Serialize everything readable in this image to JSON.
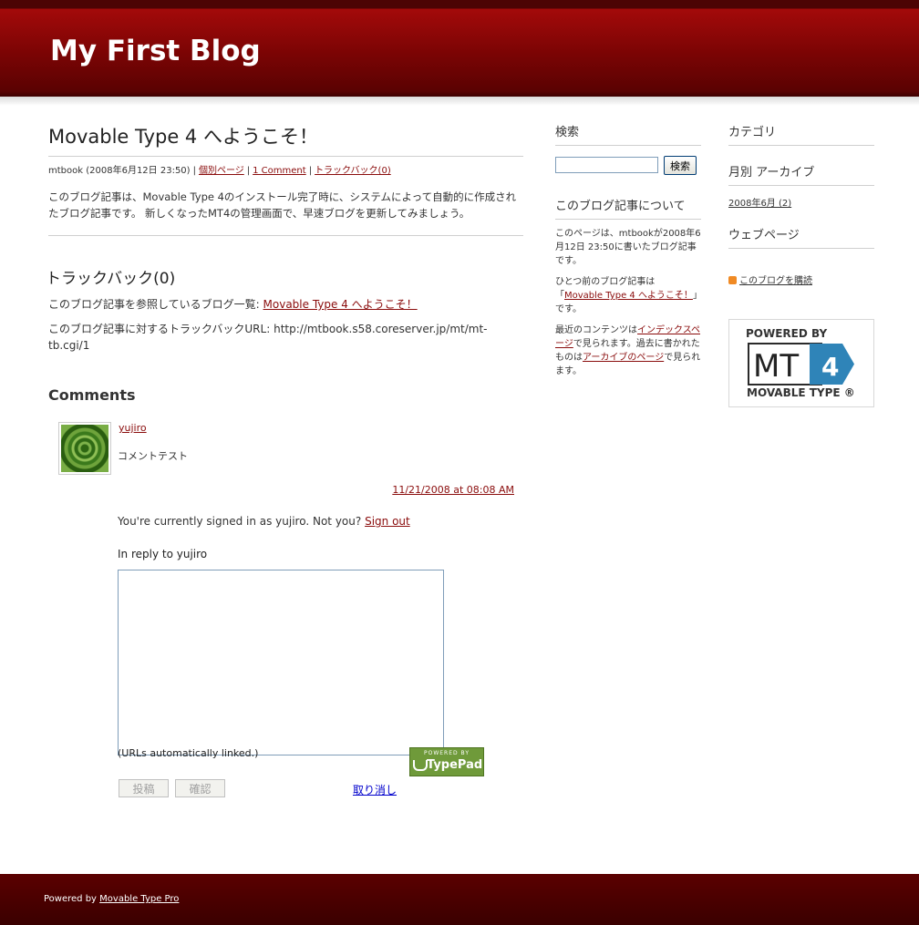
{
  "header": {
    "title": "My First Blog"
  },
  "entry": {
    "title": "Movable Type 4 へようこそ！",
    "author": "mtbook",
    "date": "(2008年6月12日 23:50)",
    "sep": "|",
    "permalink_label": "個別ページ",
    "comments_link_label": "1 Comment",
    "trackback_link_label": "トラックバック(0)",
    "body": "このブログ記事は、Movable Type 4のインストール完了時に、システムによって自動的に作成されたブログ記事です。 新しくなったMT4の管理画面で、早速ブログを更新してみましょう。"
  },
  "trackbacks": {
    "title": "トラックバック(0)",
    "list_label": "このブログ記事を参照しているブログ一覧:",
    "list_link": "Movable Type 4 へようこそ！",
    "url_label": "このブログ記事に対するトラックバックURL:",
    "url": "http://mtbook.s58.coreserver.jp/mt/mt-tb.cgi/1"
  },
  "comments": {
    "title": "Comments",
    "items": [
      {
        "author": "yujiro",
        "text": "コメントテスト",
        "date": "11/21/2008 at 08:08 AM"
      }
    ],
    "signed_in_text": "You're currently signed in as yujiro. Not you?",
    "sign_out_label": "Sign out",
    "reply_to": "In reply to yujiro",
    "textarea_value": "",
    "urls_note": "(URLs automatically linked.)",
    "typepad_small": "POWERED BY",
    "typepad_big": "TypePad",
    "post_label": "投稿",
    "preview_label": "確認",
    "cancel_label": "取り消し"
  },
  "sidebar": {
    "search_title": "検索",
    "search_value": "",
    "search_button": "検索",
    "about_title": "このブログ記事について",
    "about_p1": "このページは、mtbookが2008年6月12日 23:50に書いたブログ記事です。",
    "about_p2_pre": "ひとつ前のブログ記事は「",
    "about_p2_link": "Movable Type 4 へようこそ！",
    "about_p2_post": "」です。",
    "about_p3_pre": "最近のコンテンツは",
    "about_p3_link1": "インデックスページ",
    "about_p3_mid": "で見られます。過去に書かれたものは",
    "about_p3_link2": "アーカイブのページ",
    "about_p3_post": "で見られます。",
    "categories_title": "カテゴリ",
    "monthly_title": "月別 アーカイブ",
    "monthly_items": [
      {
        "label": "2008年6月 (2)"
      }
    ],
    "webpages_title": "ウェブページ",
    "feed_label": "このブログを購読",
    "badge_powered": "POWERED BY",
    "badge_mt": "MT",
    "badge_num": "4",
    "badge_type": "MOVABLE TYPE ®"
  },
  "footer": {
    "prefix": "Powered by",
    "link": "Movable Type Pro"
  },
  "colors": {
    "header": "#7a0404",
    "link": "#8a0c0c",
    "footer": "#4a0000"
  }
}
